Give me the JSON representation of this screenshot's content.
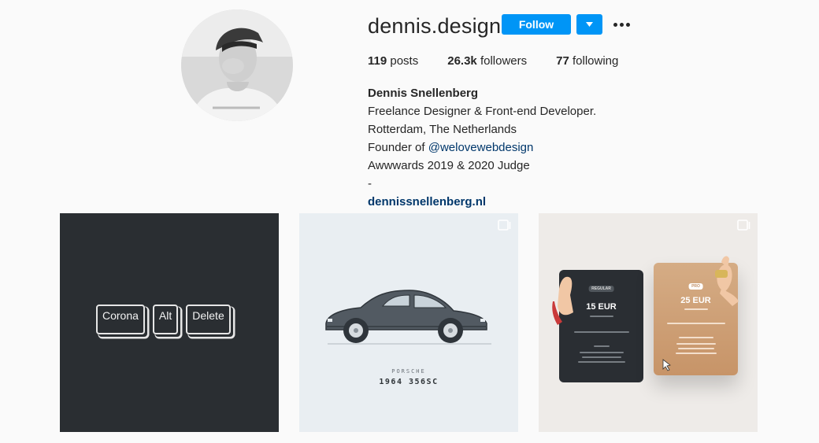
{
  "profile": {
    "username": "dennis.design",
    "follow_label": "Follow",
    "stats": {
      "posts_count": "119",
      "posts_label": "posts",
      "followers_count": "26.3k",
      "followers_label": "followers",
      "following_count": "77",
      "following_label": "following"
    },
    "bio": {
      "full_name": "Dennis Snellenberg",
      "line1": "Freelance Designer & Front-end Developer.",
      "line2": "Rotterdam, The Netherlands",
      "founder_prefix": "Founder of ",
      "founder_mention": "@welovewebdesign",
      "line4": "Awwwards 2019 & 2020 Judge",
      "line5": "-",
      "website": "dennissnellenberg.nl"
    }
  },
  "posts": [
    {
      "type": "image",
      "keys": [
        "Corona",
        "Alt",
        "Delete"
      ]
    },
    {
      "type": "carousel",
      "brand": "PORSCHE",
      "model": "1964 356SC"
    },
    {
      "type": "carousel",
      "card1_badge": "REGULAR",
      "card1_price": "15 EUR",
      "card2_badge": "PRO",
      "card2_price": "25 EUR"
    }
  ],
  "colors": {
    "accent": "#0095f6",
    "link": "#00376b",
    "text": "#262626",
    "background": "#fafafa"
  }
}
